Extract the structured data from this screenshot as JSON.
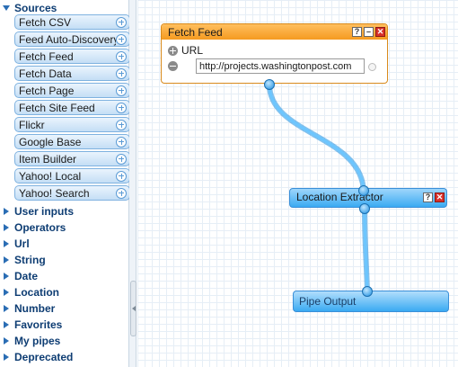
{
  "sidebar": {
    "sources": {
      "label": "Sources",
      "modules": [
        "Fetch CSV",
        "Feed Auto-Discovery",
        "Fetch Feed",
        "Fetch Data",
        "Fetch Page",
        "Fetch Site Feed",
        "Flickr",
        "Google Base",
        "Item Builder",
        "Yahoo! Local",
        "Yahoo! Search"
      ]
    },
    "categories": [
      "User inputs",
      "Operators",
      "Url",
      "String",
      "Date",
      "Location",
      "Number",
      "Favorites",
      "My pipes",
      "Deprecated"
    ]
  },
  "canvas": {
    "fetch_feed": {
      "title": "Fetch Feed",
      "field_label": "URL",
      "url_value": "http://projects.washingtonpost.com",
      "help_glyph": "?",
      "minimize_glyph": "–",
      "close_glyph": "✕"
    },
    "location_extractor": {
      "title": "Location Extractor",
      "help_glyph": "?",
      "close_glyph": "✕"
    },
    "pipe_output": {
      "title": "Pipe Output"
    }
  },
  "colors": {
    "accent_blue": "#3aaaf2",
    "module_orange": "#f59a20",
    "wire": "#33a6ef"
  },
  "icons": [
    "expand-triangle-icon",
    "collapse-triangle-icon",
    "add-module-icon",
    "help-icon",
    "minimize-icon",
    "close-icon",
    "add-field-icon",
    "remove-field-icon",
    "splitter-arrow-icon"
  ]
}
